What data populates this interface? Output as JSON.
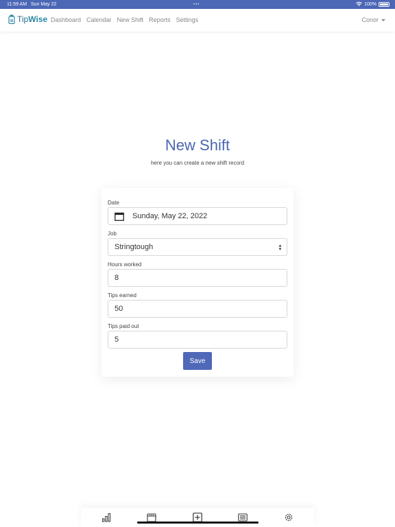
{
  "status_bar": {
    "time": "11:59 AM",
    "date": "Sun May 22",
    "multitask_dots": "•••",
    "battery": "100%"
  },
  "navbar": {
    "brand": {
      "prefix": "Tip",
      "suffix": "Wise"
    },
    "links": [
      "Dashboard",
      "Calendar",
      "New Shift",
      "Reports",
      "Settings"
    ],
    "user": "Conor"
  },
  "page": {
    "title": "New Shift",
    "subtitle": "here you can create a new shift record"
  },
  "form": {
    "date": {
      "label": "Date",
      "value": "Sunday, May 22, 2022",
      "icon": "calendar-icon"
    },
    "job": {
      "label": "Job",
      "value": "Stringtough"
    },
    "hours": {
      "label": "Hours worked",
      "value": "8"
    },
    "tips_earned": {
      "label": "Tips earned",
      "value": "50"
    },
    "tips_paid_out": {
      "label": "Tips paid out",
      "value": "5"
    },
    "save_label": "Save"
  },
  "tabbar": {
    "icons": [
      "bar-chart-icon",
      "calendar-icon",
      "add-icon",
      "list-icon",
      "settings-gear-icon"
    ]
  },
  "colors": {
    "accent": "#4f68b8",
    "status_bar": "#4b67b6",
    "brand": "#2a86a6"
  }
}
